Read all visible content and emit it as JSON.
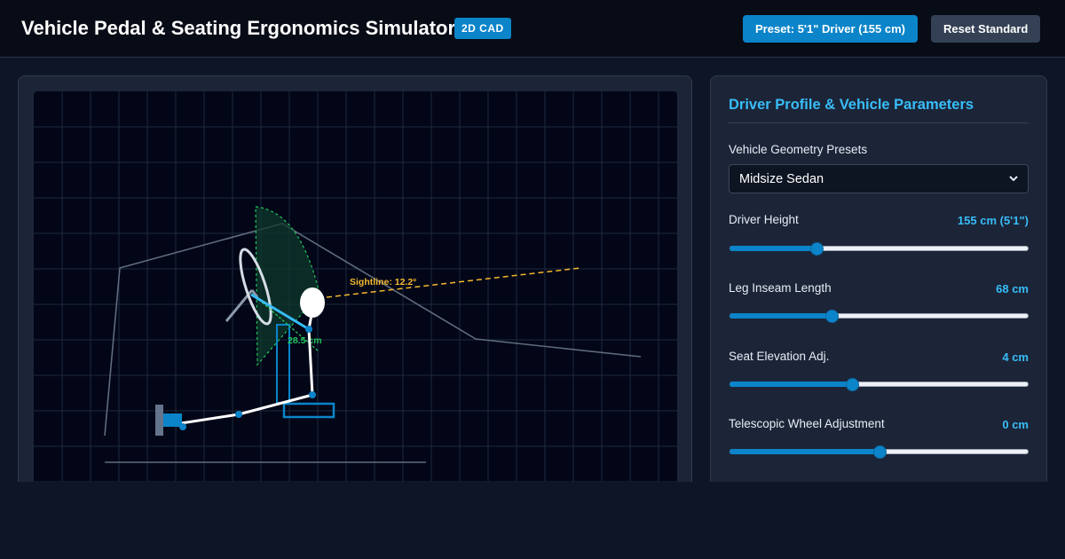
{
  "header": {
    "title": "Vehicle Pedal & Seating Ergonomics Simulator",
    "badge": "2D CAD",
    "preset_button": "Preset: 5'1\" Driver (155 cm)",
    "reset_button": "Reset Standard"
  },
  "viewport": {
    "sightline_label": "Sightline: 12.2°",
    "reach_label": "28.5 cm"
  },
  "panel": {
    "title": "Driver Profile & Vehicle Parameters",
    "geometry": {
      "label": "Vehicle Geometry Presets",
      "selected": "Midsize Sedan"
    },
    "controls": [
      {
        "label": "Driver Height",
        "value": "155 cm (5'1\")",
        "fraction": 0.29
      },
      {
        "label": "Leg Inseam Length",
        "value": "68 cm",
        "fraction": 0.34
      },
      {
        "label": "Seat Elevation Adj.",
        "value": "4 cm",
        "fraction": 0.41
      },
      {
        "label": "Telescopic Wheel Adjustment",
        "value": "0 cm",
        "fraction": 0.5
      }
    ]
  },
  "colors": {
    "accent": "#0b84c9",
    "accent_text": "#38bdf8",
    "sightline": "#f5b82e",
    "reach": "#22c55e"
  }
}
